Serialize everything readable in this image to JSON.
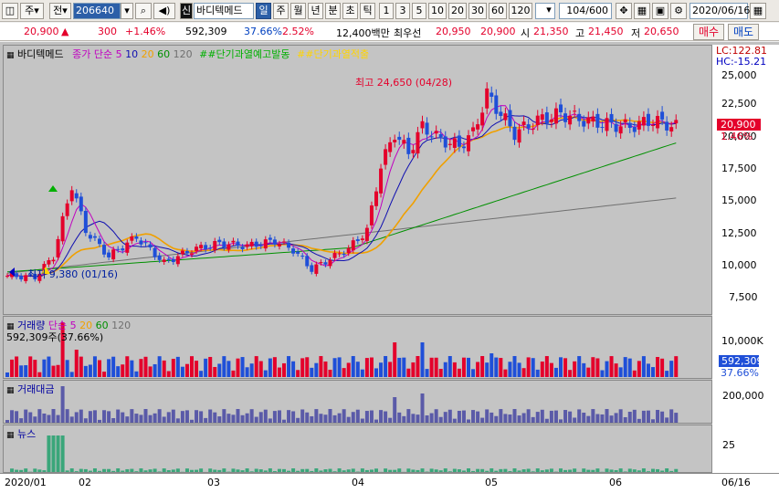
{
  "toolbar": {
    "market_type": "주",
    "market_sel": "전",
    "code": "206640",
    "name": "바디텍메드",
    "flag": "신",
    "periods": [
      "일",
      "주",
      "월",
      "년",
      "분",
      "초",
      "틱"
    ],
    "active_period": "일",
    "intervals": [
      "1",
      "3",
      "5",
      "10",
      "20",
      "30",
      "60",
      "120"
    ],
    "count": "104/600",
    "date": "2020/06/16"
  },
  "quote": {
    "price": "20,900",
    "change": "300",
    "change_pct": "+1.46%",
    "volume": "592,309",
    "vol_ratio": "37.66%",
    "turnover": "2.52%",
    "amount": "12,400백만",
    "best_ask_label": "최우선",
    "best_ask": "20,950",
    "best_bid": "20,900",
    "open_label": "시",
    "open": "21,350",
    "high_label": "고",
    "high": "21,450",
    "low_label": "저",
    "low": "20,650",
    "buy_label": "매수",
    "sell_label": "매도"
  },
  "price_legend": {
    "name": "바디텍메드",
    "ma_label": "종가 단순",
    "ma_periods": [
      "5",
      "10",
      "20",
      "60",
      "120"
    ],
    "signal1": "##단기과열예고발동",
    "signal2": "##단기과열적출"
  },
  "price_axis": {
    "lc": "LC:122.81",
    "hc": "HC:-15.21",
    "ticks": [
      "25,000",
      "22,500",
      "20,000",
      "17,500",
      "15,000",
      "12,500",
      "10,000",
      "7,500"
    ],
    "current": "20,900",
    "current_pct": "1.46%"
  },
  "annotations": {
    "high": "최고 24,650 (04/28)",
    "low": "최저 9,380 (01/16)"
  },
  "volume_legend": {
    "title": "거래량",
    "ma_label": "단순",
    "ma_periods": [
      "5",
      "20",
      "60",
      "120"
    ],
    "value": "592,309주(37.66%)"
  },
  "volume_axis": {
    "tick": "10,000K",
    "current": "592,309",
    "current_pct": "37.66%"
  },
  "amount_legend": {
    "title": "거래대금"
  },
  "amount_axis": {
    "tick": "200,000"
  },
  "news_legend": {
    "title": "뉴스"
  },
  "news_axis": {
    "tick": "25"
  },
  "x_axis": {
    "labels": [
      "2020/01",
      "02",
      "03",
      "04",
      "05",
      "06"
    ],
    "end_label": "06/16"
  },
  "colors": {
    "up": "#e4002b",
    "down": "#1f4fd8",
    "ma5": "#c000c0",
    "ma10": "#1010b0",
    "ma20": "#f0a000",
    "ma60": "#009000",
    "ma120": "#707070",
    "bg": "#c4c4c4"
  }
}
